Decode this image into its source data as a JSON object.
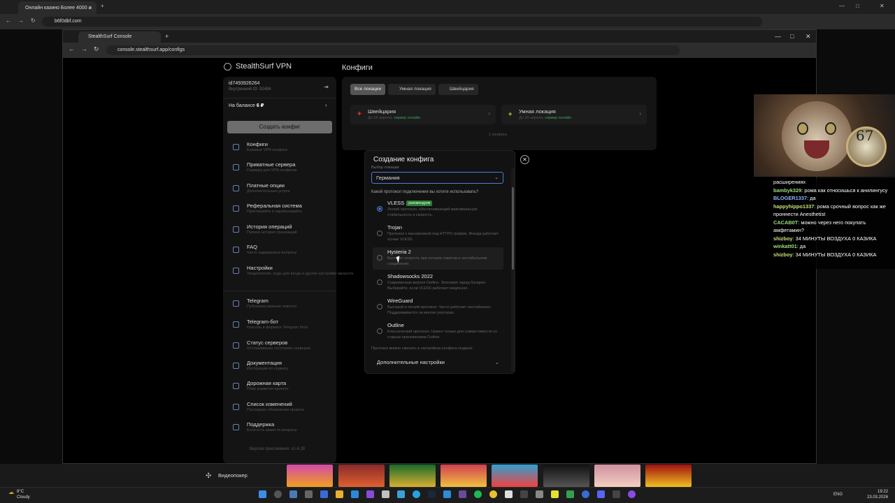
{
  "outer_browser": {
    "tab_title": "Онлайн казино Более 4000 и",
    "url": "b6f0dbf.com"
  },
  "inner_browser": {
    "tab_title": "StealthSurf Console",
    "url": "console.stealthsurf.app/configs"
  },
  "brand": {
    "name": "StealthSurf VPN"
  },
  "account": {
    "id": "id7493926264",
    "internal_id": "Внутренний ID: 92484",
    "balance_label": "На балансе",
    "balance_value": "6 ₽"
  },
  "sidebar": {
    "create_button": "Создать конфиг",
    "items": [
      {
        "label": "Конфиги",
        "sub": "Базовые VPN конфиги"
      },
      {
        "label": "Приватные сервера",
        "sub": "Сервера для VPN конфигов"
      },
      {
        "label": "Платные опции",
        "sub": "Дополнительные услуги"
      },
      {
        "label": "Реферальная система",
        "sub": "Приглашайте и зарабатывайте"
      },
      {
        "label": "История операций",
        "sub": "Полная история транзакций"
      },
      {
        "label": "FAQ",
        "sub": "Часто задаваемые вопросы"
      },
      {
        "label": "Настройки",
        "sub": "Уведомления, ходы для входа и другие настройки аккаунта"
      },
      {
        "label": "Telegram",
        "sub": "Публикуем важные новости"
      },
      {
        "label": "Telegram-бот",
        "sub": "Консоль в формате Telegram бота"
      },
      {
        "label": "Статус серверов",
        "sub": "Отслеживание состояния серверов"
      },
      {
        "label": "Документация",
        "sub": "Инструкции по сервису"
      },
      {
        "label": "Дорожная карта",
        "sub": "План развития проекта"
      },
      {
        "label": "Список изменений",
        "sub": "Последние обновления проекта"
      },
      {
        "label": "Поддержка",
        "sub": "Если есть какие-то вопросы"
      }
    ],
    "version": "Версия приложения: v1.4.28"
  },
  "main": {
    "title": "Конфиги",
    "filters": [
      "Все локации",
      "Умная локация",
      "Швейцария"
    ],
    "locations": [
      {
        "name": "Швейцария",
        "date": "До 26 апреля,",
        "status": "сервер онлайн"
      },
      {
        "name": "Умная локация",
        "date": "До 20 апреля,",
        "status": "сервер онлайн"
      }
    ],
    "count": "2 конфига"
  },
  "modal": {
    "title": "Создание конфига",
    "location_label": "Выбор локации",
    "location_value": "Германия",
    "protocol_question": "Какой протокол подключения вы хотите использовать?",
    "protocols": [
      {
        "name": "VLESS",
        "badge": "рекомендуем",
        "desc": "Легкий протокол, обеспечивающий максимальную стабильность и скорость.",
        "selected": true
      },
      {
        "name": "Trojan",
        "desc": "Протокол с маскировкой под HTTPS-трафик. Иногда работает лучше VLESS.",
        "selected": false
      },
      {
        "name": "Hysteria 2",
        "desc": "Высокая скорость при потерях пакетов и нестабильном соединении.",
        "selected": false
      },
      {
        "name": "Shadowsocks 2022",
        "desc": "Современная версия Outline. Экономит заряд батареи. Выбирайте, если VLESS работает медленно.",
        "selected": false
      },
      {
        "name": "WireGuard",
        "desc": "Быстрый и легкий протокол. Часто работает нестабильно. Поддерживается на многих роутерах.",
        "selected": false
      },
      {
        "name": "Outline",
        "desc": "Классический протокол. Нужен только для совместимости со старым приложением Outline.",
        "selected": false
      }
    ],
    "protocol_note": "Протокол можно сменить в настройках конфига позднее.",
    "advanced": "Дополнительные настройки"
  },
  "chat": [
    {
      "user": "",
      "text": "расширениях",
      "color": "#ffffff"
    },
    {
      "user": "bambyk329",
      "text": ": рома как относишься к анилингусу",
      "color": "#9be07a"
    },
    {
      "user": "BLOGER1337",
      "text": ": да",
      "color": "#8fb8ff"
    },
    {
      "user": "happyhippo1337",
      "text": ": рома срочный вопрос как же проннести Anesthetist",
      "color": "#c9e07a"
    },
    {
      "user": "CACAB0T",
      "text": ": можно через него покупать амфетамин?",
      "color": "#9be07a"
    },
    {
      "user": "shizboy",
      "text": ": 34 МИНУТЫ ВОЗДУХА 0 КАЗИКА",
      "color": "#c9e07a"
    },
    {
      "user": "winkatt01",
      "text": ": да",
      "color": "#9be07a"
    },
    {
      "user": "shizboy",
      "text": ": 34 МИНУТЫ ВОЗДУХА 0 КАЗИКА",
      "color": "#c9e07a"
    }
  ],
  "overlay": {
    "watch_text": "67"
  },
  "bottom": {
    "category": "Видеопокер"
  },
  "taskbar": {
    "weather_temp": "8°C",
    "weather_desc": "Cloudy",
    "lang": "ENG",
    "time": "19:22",
    "date": "23.03.2026"
  },
  "colors": {
    "accent": "#4c7be0",
    "online": "#3aa55a"
  }
}
